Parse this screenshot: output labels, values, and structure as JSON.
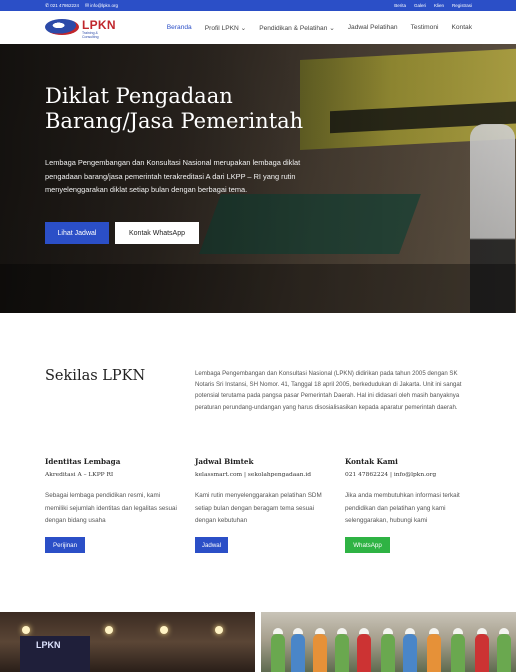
{
  "topbar": {
    "phone": "021 47862224",
    "email": "info@lpkn.org",
    "links": [
      "Berita",
      "Galeri",
      "Klien",
      "Registrasi"
    ]
  },
  "logo": {
    "name": "LPKN",
    "tagline": "Training & Consulting"
  },
  "nav": {
    "items": [
      "Beranda",
      "Profil LPKN",
      "Pendidikan & Pelatihan",
      "Jadwal Pelatihan",
      "Testimoni",
      "Kontak"
    ],
    "active": "Beranda",
    "accent_color": "#2b4fc7"
  },
  "hero": {
    "title": "Diklat Pengadaan Barang/Jasa Pemerintah",
    "description": "Lembaga Pengembangan dan Konsultasi Nasional merupakan lembaga diklat pengadaan barang/jasa pemerintah terakreditasi A dari LKPP – RI yang rutin menyelenggarakan diklat setiap bulan dengan berbagai tema.",
    "primary_button": "Lihat Jadwal",
    "secondary_button": "Kontak WhatsApp"
  },
  "sekilas": {
    "title": "Sekilas LPKN",
    "text": "Lembaga Pengembangan dan Konsultasi Nasional (LPKN) didirikan pada tahun 2005 dengan SK Notaris Sri Instansi, SH Nomor. 41, Tanggal 18 april 2005, berkedudukan di Jakarta. Unit ini sangat potensial terutama pada pangsa pasar Pemerintah Daerah. Hal ini didasari oleh masih banyaknya peraturan perundang-undangan yang harus disosialisasikan kepada aparatur pemerintah daerah."
  },
  "columns": [
    {
      "title": "Identitas Lembaga",
      "subtitle": "Akreditasi A – LKPP RI",
      "description": "Sebagai lembaga pendidikan resmi, kami memiliki sejumlah identitas dan legalitas sesuai dengan bidang usaha",
      "button": "Perijinan",
      "button_color": "#2b4fc7"
    },
    {
      "title": "Jadwal Bimtek",
      "subtitle": "kelassmart.com | sekolahpengadaan.id",
      "description": "Kami rutin menyelenggarakan pelatihan SDM setiap bulan dengan beragam tema sesuai dengan kebutuhan",
      "button": "Jadwal",
      "button_color": "#2b4fc7"
    },
    {
      "title": "Kontak Kami",
      "subtitle": "021 47862224 | info@lpkn.org",
      "description": "Jika anda membutuhkan informasi terkait pendidikan dan pelatihan yang kami selenggarakan, hubungi kami",
      "button": "WhatsApp",
      "button_color": "#2fb344"
    }
  ],
  "photos": {
    "screen_text": "LPKN"
  }
}
